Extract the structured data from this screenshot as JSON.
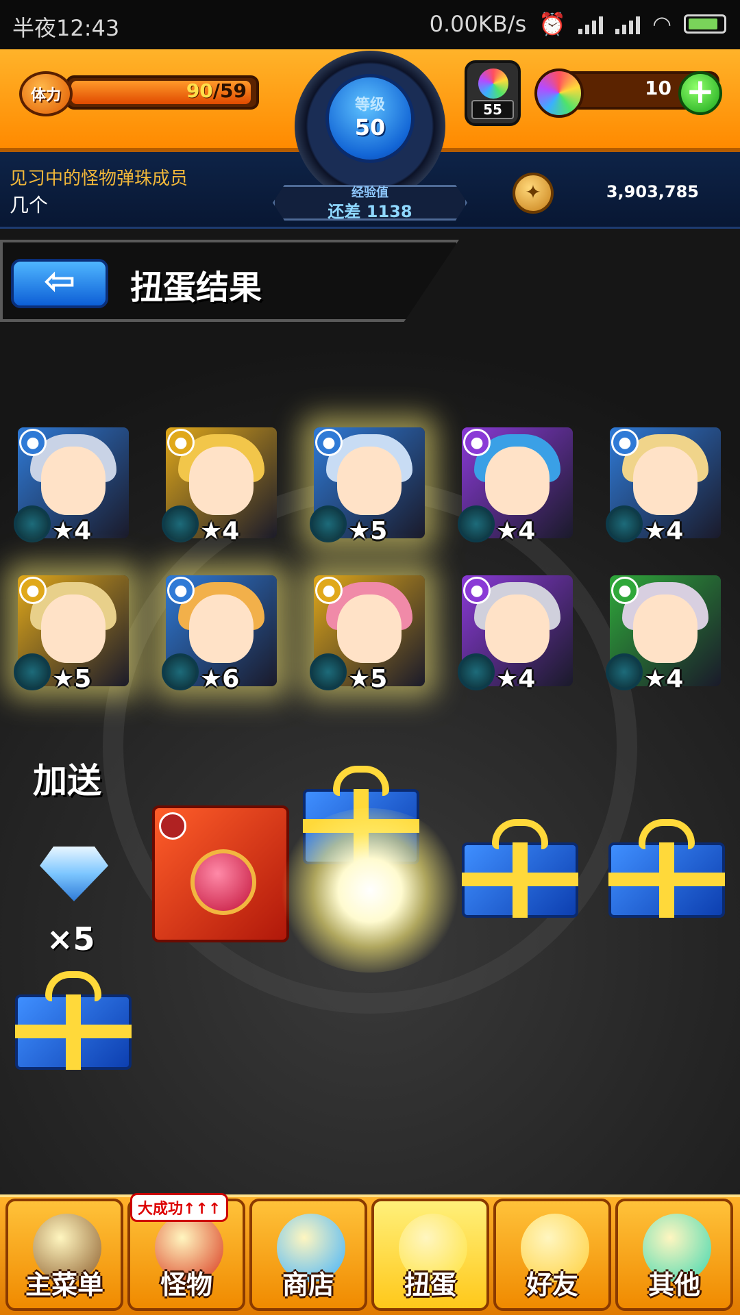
{
  "status_bar": {
    "time": "半夜12:43",
    "network_speed": "0.00KB/s",
    "icons": [
      "alarm-icon",
      "signal-icon",
      "signal-icon",
      "wifi-icon",
      "battery-charging-icon"
    ]
  },
  "header": {
    "stamina_label": "体力",
    "stamina_current": "90",
    "stamina_max": "/59",
    "level_label": "等级",
    "level": "50",
    "exp_label": "经验值",
    "exp_remaining": "还差 1138",
    "flask_count": "55",
    "orb_count": "10",
    "plus_symbol": "+",
    "rank_title": "见习中的怪物弹珠成员",
    "rank_sub": "几个",
    "coins": "3,903,785"
  },
  "page": {
    "back_symbol": "⇦",
    "title": "扭蛋结果"
  },
  "monsters": [
    {
      "stars": "★4",
      "element": "water",
      "elem_color": "#2f7ad6",
      "hair_color": "#c9d3e6",
      "glow": false
    },
    {
      "stars": "★4",
      "element": "light",
      "elem_color": "#e0a81a",
      "hair_color": "#f2c64a",
      "glow": false
    },
    {
      "stars": "★5",
      "element": "water",
      "elem_color": "#2f7ad6",
      "hair_color": "#c8dcf4",
      "glow": true
    },
    {
      "stars": "★4",
      "element": "dark",
      "elem_color": "#8a3ad6",
      "hair_color": "#3aa0e6",
      "glow": false
    },
    {
      "stars": "★4",
      "element": "water",
      "elem_color": "#2f7ad6",
      "hair_color": "#f0d48a",
      "glow": false
    },
    {
      "stars": "★5",
      "element": "light",
      "elem_color": "#e0a81a",
      "hair_color": "#e8d08a",
      "glow": true
    },
    {
      "stars": "★6",
      "element": "water",
      "elem_color": "#2f7ad6",
      "hair_color": "#f2b04a",
      "glow": true
    },
    {
      "stars": "★5",
      "element": "light",
      "elem_color": "#e0a81a",
      "hair_color": "#f08aa8",
      "glow": true
    },
    {
      "stars": "★4",
      "element": "dark",
      "elem_color": "#8a3ad6",
      "hair_color": "#d0d0dc",
      "glow": false
    },
    {
      "stars": "★4",
      "element": "wood",
      "elem_color": "#2fa83a",
      "hair_color": "#d8cfe0",
      "glow": false
    }
  ],
  "bonus": {
    "label": "加送",
    "diamond_count": "×5"
  },
  "nav": [
    {
      "label": "主菜单",
      "icon": "home-gate-icon",
      "color": "#8a5a2a"
    },
    {
      "label": "怪物",
      "icon": "monster-icon",
      "color": "#d8341a"
    },
    {
      "label": "商店",
      "icon": "rainbow-orb-icon",
      "color": "#3ab0ff"
    },
    {
      "label": "扭蛋",
      "icon": "egg-icon",
      "color": "#ffe23a"
    },
    {
      "label": "好友",
      "icon": "friends-icon",
      "color": "#ffcf3a"
    },
    {
      "label": "其他",
      "icon": "question-icon",
      "color": "#3ad6b0"
    }
  ],
  "nav_badge": "大成功↑↑↑"
}
